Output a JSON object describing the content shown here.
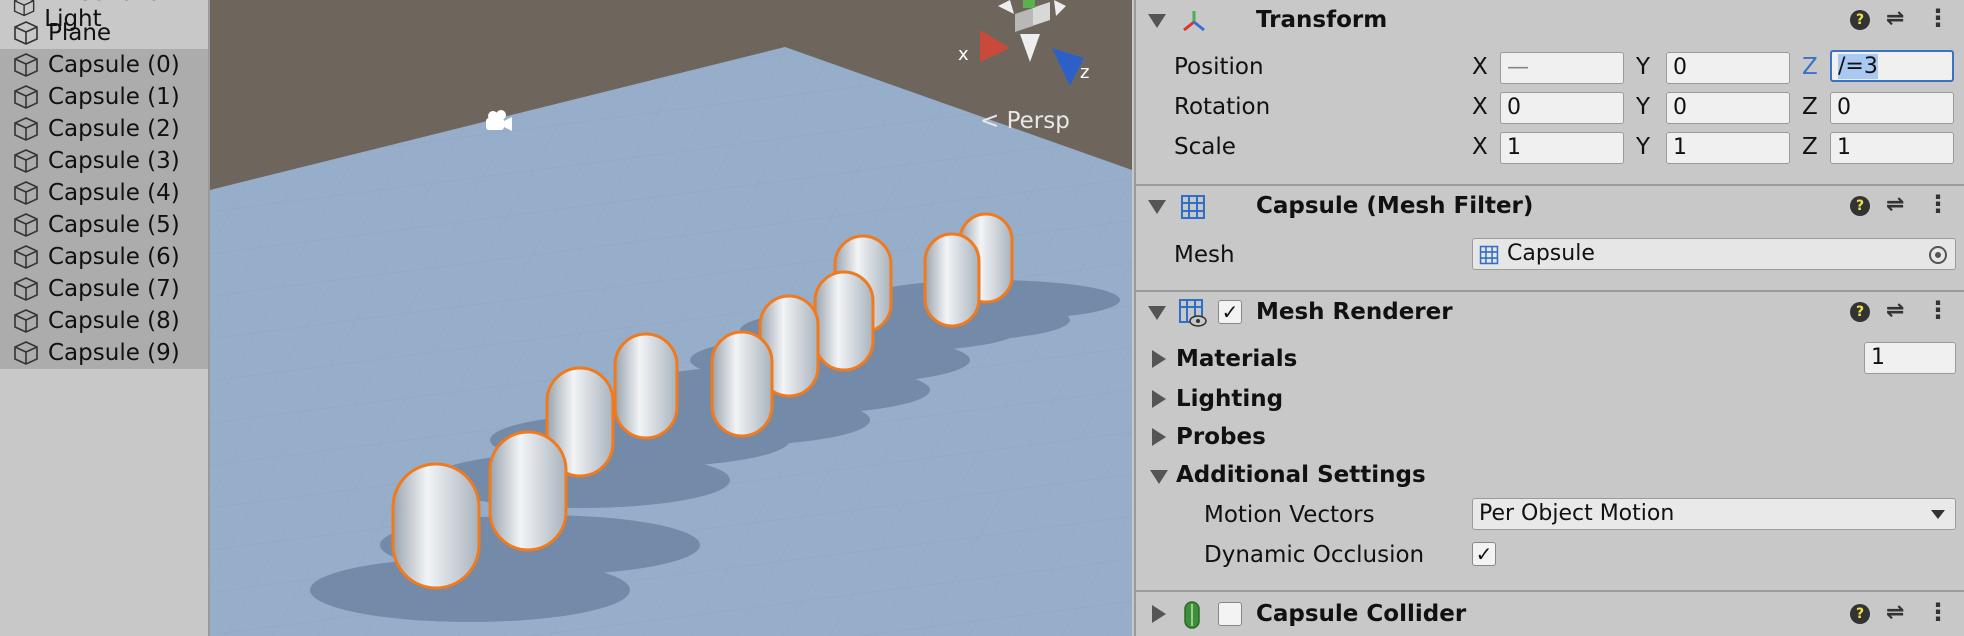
{
  "hierarchy": {
    "items": [
      {
        "label": "Directional Light",
        "selected": false
      },
      {
        "label": "Plane",
        "selected": false
      },
      {
        "label": "Capsule (0)",
        "selected": true
      },
      {
        "label": "Capsule (1)",
        "selected": true
      },
      {
        "label": "Capsule (2)",
        "selected": true
      },
      {
        "label": "Capsule (3)",
        "selected": true
      },
      {
        "label": "Capsule (4)",
        "selected": true
      },
      {
        "label": "Capsule (5)",
        "selected": true
      },
      {
        "label": "Capsule (6)",
        "selected": true
      },
      {
        "label": "Capsule (7)",
        "selected": true
      },
      {
        "label": "Capsule (8)",
        "selected": true
      },
      {
        "label": "Capsule (9)",
        "selected": true
      }
    ]
  },
  "scene": {
    "persp_label": "< Persp",
    "gizmo": {
      "x_label": "x",
      "z_label": "z"
    }
  },
  "inspector": {
    "transform": {
      "title": "Transform",
      "position": {
        "label": "Position",
        "x": "—",
        "y": "0",
        "z": "/=3"
      },
      "rotation": {
        "label": "Rotation",
        "x": "0",
        "y": "0",
        "z": "0"
      },
      "scale": {
        "label": "Scale",
        "x": "1",
        "y": "1",
        "z": "1"
      },
      "axes": {
        "x": "X",
        "y": "Y",
        "z": "Z"
      }
    },
    "mesh_filter": {
      "title": "Capsule (Mesh Filter)",
      "mesh_label": "Mesh",
      "mesh_value": "Capsule"
    },
    "mesh_renderer": {
      "title": "Mesh Renderer",
      "enabled": true,
      "materials_label": "Materials",
      "materials_count": "1",
      "lighting_label": "Lighting",
      "probes_label": "Probes",
      "additional_label": "Additional Settings",
      "motion_vectors_label": "Motion Vectors",
      "motion_vectors_value": "Per Object Motion",
      "dynamic_occlusion_label": "Dynamic Occlusion",
      "dynamic_occlusion": true
    },
    "capsule_collider": {
      "title": "Capsule Collider",
      "enabled": false
    },
    "help_glyph": "?",
    "menu_glyph": "⋮",
    "presets_glyph": "⇌",
    "check_glyph": "✓"
  },
  "colors": {
    "selection_outline": "#f07a1e",
    "accent": "#3a72c4"
  }
}
